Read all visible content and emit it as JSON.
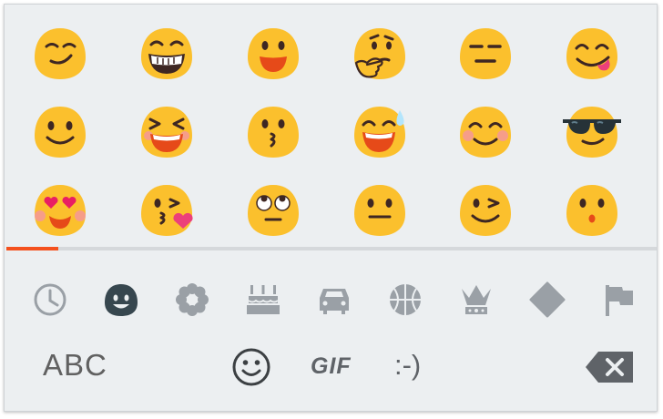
{
  "colors": {
    "background": "#eceff1",
    "accent": "#f4511e",
    "icon_inactive": "#9aa0a6",
    "icon_active": "#37474f",
    "emoji_yellow": "#fbc02d"
  },
  "emoji_grid": {
    "rows": [
      [
        "smirking-face",
        "grinning-face-with-teeth",
        "smiling-face-open-mouth",
        "thinking-face",
        "expressionless-face",
        "face-savoring-food"
      ],
      [
        "slightly-smiling-face",
        "laughing-squinting-face",
        "kissing-face",
        "grinning-face-with-sweat",
        "smiling-face-blushing",
        "smiling-face-with-sunglasses"
      ],
      [
        "heart-eyes-face",
        "face-blowing-kiss",
        "face-with-rolling-eyes",
        "neutral-face",
        "winking-face",
        "hushed-face"
      ]
    ]
  },
  "scroll_indicator": {
    "progress": 0.08
  },
  "categories": {
    "selected": "smileys",
    "items": [
      "recent-clock-icon",
      "smileys-icon",
      "nature-flower-icon",
      "food-cake-icon",
      "travel-car-icon",
      "activity-ball-icon",
      "objects-crown-icon",
      "symbols-diamond-icon",
      "flags-icon"
    ]
  },
  "bottom_bar": {
    "abc_label": "ABC",
    "gif_label": "GIF",
    "emoticon_label": ":-)",
    "emoji_key_icon": "smiley-outline-icon",
    "backspace_icon": "backspace-icon"
  }
}
